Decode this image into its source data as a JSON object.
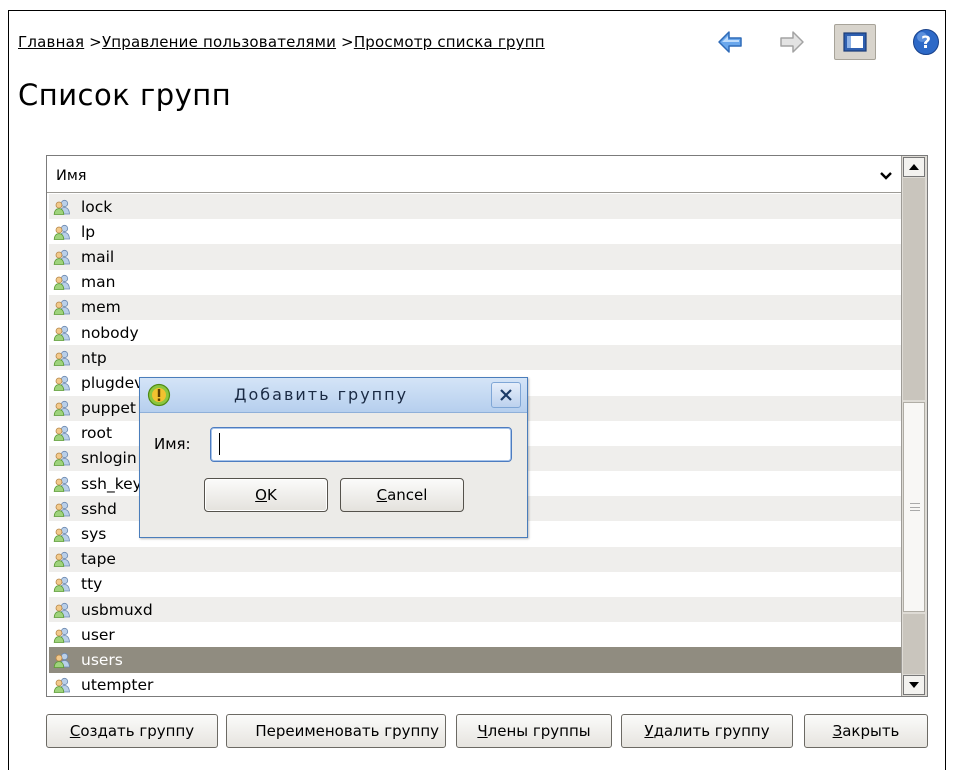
{
  "breadcrumb": {
    "items": [
      {
        "label": "Главная"
      },
      {
        "label": "Управление пользователями"
      },
      {
        "label": "Просмотр списка групп"
      }
    ],
    "separator": " >"
  },
  "page_title": "Список групп",
  "list": {
    "column_header": "Имя",
    "rows": [
      {
        "name": "lock"
      },
      {
        "name": "lp"
      },
      {
        "name": "mail"
      },
      {
        "name": "man"
      },
      {
        "name": "mem"
      },
      {
        "name": "nobody"
      },
      {
        "name": "ntp"
      },
      {
        "name": "plugdev"
      },
      {
        "name": "puppet"
      },
      {
        "name": "root"
      },
      {
        "name": "snlogin"
      },
      {
        "name": "ssh_keys"
      },
      {
        "name": "sshd"
      },
      {
        "name": "sys"
      },
      {
        "name": "tape"
      },
      {
        "name": "tty"
      },
      {
        "name": "usbmuxd"
      },
      {
        "name": "user"
      },
      {
        "name": "users",
        "selected": true
      },
      {
        "name": "utempter"
      }
    ]
  },
  "buttons": {
    "create": {
      "mnemonic": "С",
      "rest": "оздать группу"
    },
    "rename": {
      "label": "Переименовать группу",
      "mnemonic": "",
      "rest": ""
    },
    "members": {
      "mnemonic": "Ч",
      "rest": "лены группы"
    },
    "delete": {
      "mnemonic": "У",
      "rest": "далить группу"
    },
    "close": {
      "mnemonic": "З",
      "rest": "акрыть"
    }
  },
  "dialog": {
    "title": "Добавить группу",
    "field_label": "Имя:",
    "field_value": "",
    "ok": {
      "mnemonic": "O",
      "rest": "K"
    },
    "cancel": {
      "mnemonic": "C",
      "rest": "ancel"
    }
  },
  "icons": {
    "back": "arrow-left-icon",
    "forward": "arrow-right-icon",
    "panel": "panel-toggle-icon",
    "help": "help-icon",
    "group": "group-icon",
    "dialog": "warning-icon",
    "close": "close-icon"
  },
  "colors": {
    "selected_row": "#908c80",
    "odd_row": "#efeeec",
    "dialog_title_bg": "#b6cfee",
    "nav_arrow": "#4f8edc"
  }
}
